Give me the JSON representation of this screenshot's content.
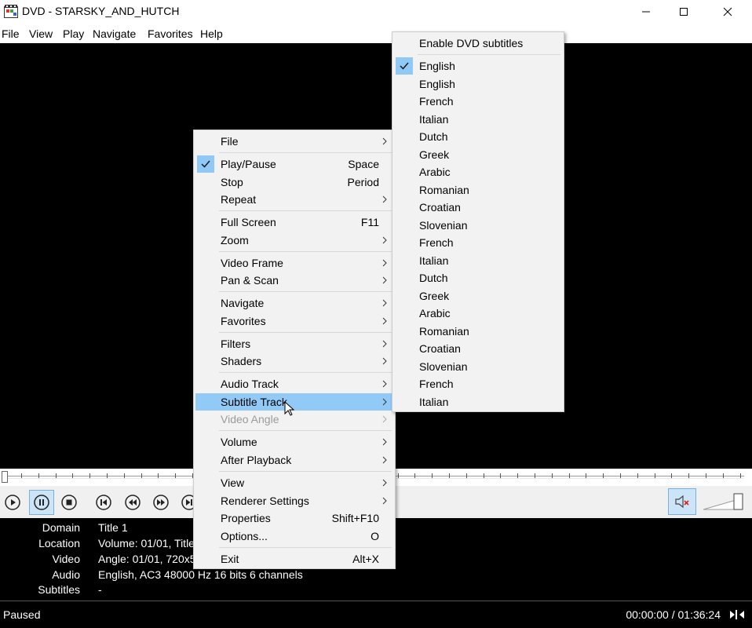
{
  "window": {
    "title": "DVD - STARSKY_AND_HUTCH"
  },
  "menubar": {
    "items": [
      "File",
      "View",
      "Play",
      "Navigate",
      "Favorites",
      "Help"
    ]
  },
  "context_menu": {
    "items": [
      {
        "label": "File",
        "accel": "",
        "submenu": true
      },
      {
        "label": "Play/Pause",
        "accel": "Space",
        "checked": true
      },
      {
        "label": "Stop",
        "accel": "Period"
      },
      {
        "label": "Repeat",
        "accel": "",
        "submenu": true
      },
      {
        "label": "Full Screen",
        "accel": "F11"
      },
      {
        "label": "Zoom",
        "accel": "",
        "submenu": true
      },
      {
        "label": "Video Frame",
        "accel": "",
        "submenu": true
      },
      {
        "label": "Pan & Scan",
        "accel": "",
        "submenu": true
      },
      {
        "label": "Navigate",
        "accel": "",
        "submenu": true
      },
      {
        "label": "Favorites",
        "accel": "",
        "submenu": true
      },
      {
        "label": "Filters",
        "accel": "",
        "submenu": true
      },
      {
        "label": "Shaders",
        "accel": "",
        "submenu": true
      },
      {
        "label": "Audio Track",
        "accel": "",
        "submenu": true
      },
      {
        "label": "Subtitle Track",
        "accel": "",
        "submenu": true,
        "highlighted": true
      },
      {
        "label": "Video Angle",
        "accel": "",
        "submenu": true,
        "disabled": true
      },
      {
        "label": "Volume",
        "accel": "",
        "submenu": true
      },
      {
        "label": "After Playback",
        "accel": "",
        "submenu": true
      },
      {
        "label": "View",
        "accel": "",
        "submenu": true
      },
      {
        "label": "Renderer Settings",
        "accel": "",
        "submenu": true
      },
      {
        "label": "Properties",
        "accel": "Shift+F10"
      },
      {
        "label": "Options...",
        "accel": "O"
      },
      {
        "label": "Exit",
        "accel": "Alt+X"
      }
    ]
  },
  "subtitle_menu": {
    "enable_label": "Enable DVD subtitles",
    "tracks": [
      {
        "label": "English",
        "checked": true
      },
      {
        "label": "English"
      },
      {
        "label": "French"
      },
      {
        "label": "Italian"
      },
      {
        "label": "Dutch"
      },
      {
        "label": "Greek"
      },
      {
        "label": "Arabic"
      },
      {
        "label": "Romanian"
      },
      {
        "label": "Croatian"
      },
      {
        "label": "Slovenian"
      },
      {
        "label": "French"
      },
      {
        "label": "Italian"
      },
      {
        "label": "Dutch"
      },
      {
        "label": "Greek"
      },
      {
        "label": "Arabic"
      },
      {
        "label": "Romanian"
      },
      {
        "label": "Croatian"
      },
      {
        "label": "Slovenian"
      },
      {
        "label": "French"
      },
      {
        "label": "Italian"
      }
    ]
  },
  "info_panel": {
    "rows": [
      {
        "label": "Domain",
        "value": "Title 1"
      },
      {
        "label": "Location",
        "value": "Volume: 01/01, Title"
      },
      {
        "label": "Video",
        "value": "Angle: 01/01, 720x5"
      },
      {
        "label": "Audio",
        "value": "English, AC3 48000 Hz 16 bits 6 channels"
      },
      {
        "label": "Subtitles",
        "value": "-"
      }
    ]
  },
  "status": {
    "state": "Paused",
    "time": "00:00:00 / 01:36:24"
  },
  "icons": {
    "toolbar": [
      "play-icon",
      "pause-icon",
      "stop-icon",
      "skip-back-icon",
      "rewind-icon",
      "fast-forward-icon",
      "skip-forward-icon"
    ],
    "mute": "speaker-muted-icon"
  },
  "colors": {
    "highlight": "#91c9f7",
    "check_bg": "#90c8f6",
    "disabled_text": "#9b9b9b"
  }
}
